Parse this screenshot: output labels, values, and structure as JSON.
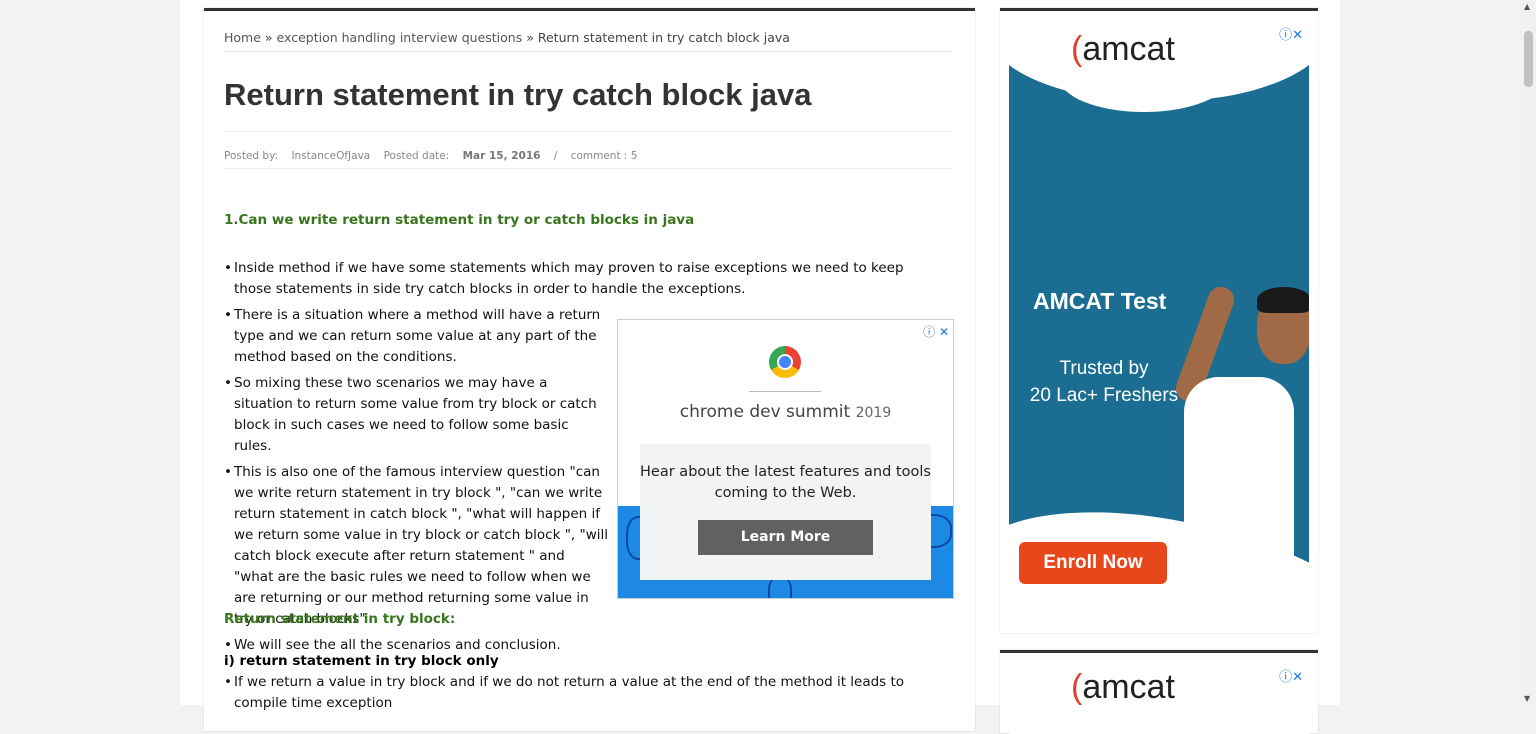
{
  "breadcrumb": {
    "home": "Home",
    "sep1": "»",
    "category": "exception handling interview questions",
    "sep2": "»",
    "current": "Return statement in try catch block java"
  },
  "post": {
    "title": "Return statement in try catch block java",
    "posted_by_label": "Posted by:",
    "author": "InstanceOfJava",
    "posted_date_label": "Posted date:",
    "date": "Mar 15, 2016",
    "slash": "/",
    "comments": "comment : 5"
  },
  "content": {
    "question1": "1.Can we write return statement in try or catch blocks in java",
    "bullets": [
      "Inside method if we have some statements which may proven to raise exceptions we need to keep those statements in side try catch blocks in order to handle the exceptions.",
      "There is a situation where a method will have a return type and we can return some value at any part of the method based on the conditions.",
      "So mixing these two scenarios we may have a situation to return some value from try block or catch block in such cases we need to follow some basic rules.",
      "This is also one of the famous interview question  \"can we write return statement in try block \", \"can we write return statement in catch block \", \"what will happen if we return some value in try block or catch block \", \"will catch block execute after return statement \" and \"what are the basic rules we need to follow when we are returning or our method returning some value in try or catch blocks\"",
      "We will see the all the scenarios and conclusion."
    ],
    "section_heading": "Return statement in try block:",
    "sub_heading": "i) return statement in try block only",
    "bullets2": [
      "If we return a value in try block and if we do not return a value at the end of the method it leads to compile time exception"
    ]
  },
  "ad_inline": {
    "title": "chrome dev summit",
    "year": "2019",
    "text": "Hear about the latest features and tools coming to the Web.",
    "button": "Learn More",
    "info_icon": "ⓘ",
    "close_icon": "✕"
  },
  "ad_side": {
    "logo_prefix": "(",
    "logo": "amcat",
    "headline": "AMCAT Test",
    "tag1": "Trusted by",
    "tag2": "20 Lac+ Freshers",
    "button": "Enroll Now",
    "info_close": "ⓘ✕"
  },
  "colors": {
    "heading_green": "#38761d",
    "amcat_blue": "#1b6e91",
    "amcat_orange": "#e8471c"
  }
}
